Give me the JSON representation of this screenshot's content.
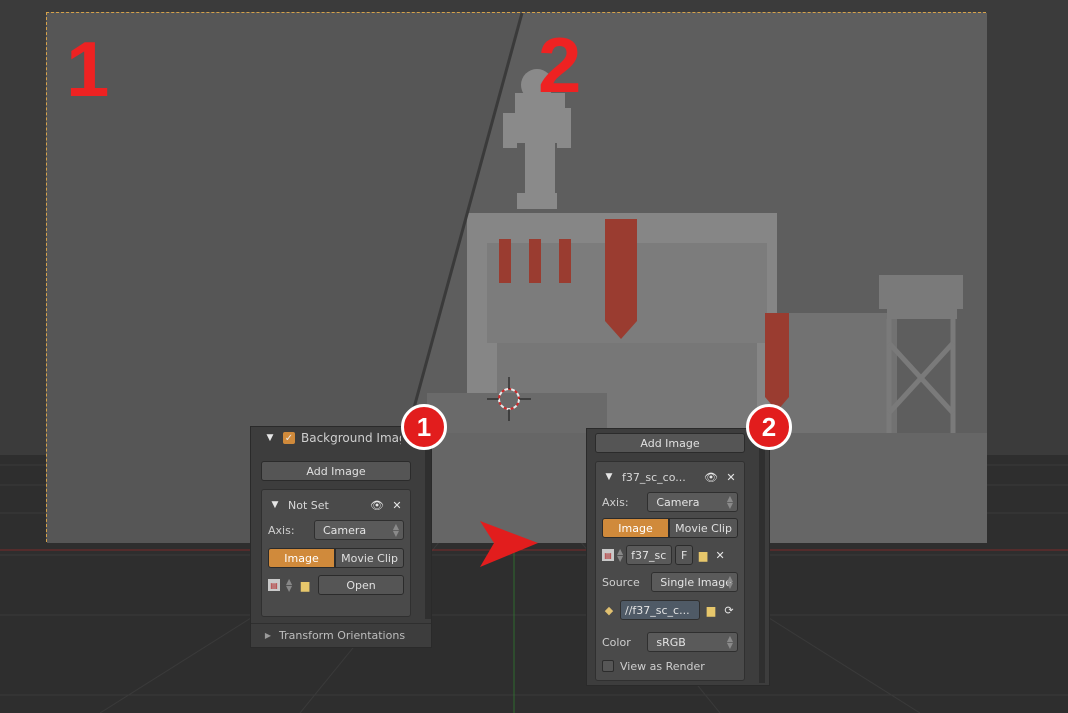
{
  "annotations": {
    "left_number": "1",
    "right_number": "2",
    "badge_left": "1",
    "badge_right": "2"
  },
  "colors": {
    "accent_orange": "#d08a3b",
    "annotation_red": "#e21d1d",
    "camera_border": "#d6a24a"
  },
  "panel_left": {
    "section_title": "Background Images",
    "add_image_label": "Add Image",
    "entry_name": "Not Set",
    "axis_label": "Axis:",
    "axis_value": "Camera",
    "tab_image": "Image",
    "tab_movie_clip": "Movie Clip",
    "open_label": "Open",
    "transform_section": "Transform Orientations"
  },
  "panel_right": {
    "add_image_label": "Add Image",
    "entry_name": "f37_sc_co...",
    "axis_label": "Axis:",
    "axis_value": "Camera",
    "tab_image": "Image",
    "tab_movie_clip": "Movie Clip",
    "image_name": "f37_sc",
    "fake_user": "F",
    "source_label": "Source",
    "source_value": "Single Image",
    "filepath": "//f37_sc_c...",
    "color_label": "Color",
    "color_value": "sRGB",
    "view_as_render": "View as Render"
  }
}
